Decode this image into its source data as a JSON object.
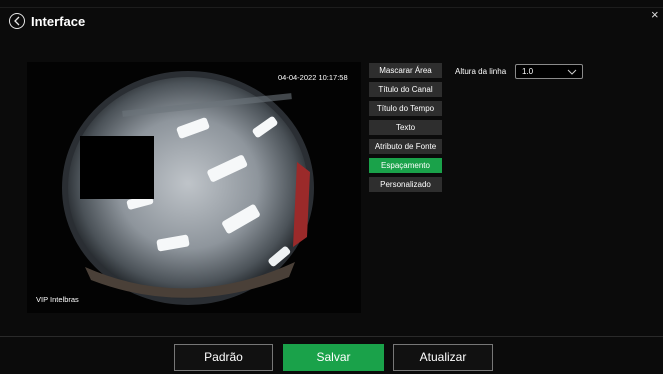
{
  "header": {
    "title": "Interface"
  },
  "preview": {
    "timestamp": "04-04-2022 10:17:58",
    "channel_name": "VIP Intelbras"
  },
  "menu": {
    "items": [
      {
        "label": "Mascarar Área"
      },
      {
        "label": "Título do Canal"
      },
      {
        "label": "Título do Tempo"
      },
      {
        "label": "Texto"
      },
      {
        "label": "Atributo de Fonte"
      },
      {
        "label": "Espaçamento",
        "active": true
      },
      {
        "label": "Personalizado"
      }
    ]
  },
  "settings": {
    "line_height_label": "Altura da linha",
    "line_height_value": "1.0"
  },
  "actions": {
    "default_label": "Padrão",
    "save_label": "Salvar",
    "refresh_label": "Atualizar"
  },
  "colors": {
    "background": "#0b0b0b",
    "accent": "#1aa24a",
    "menu_button": "#2e2e2e"
  }
}
